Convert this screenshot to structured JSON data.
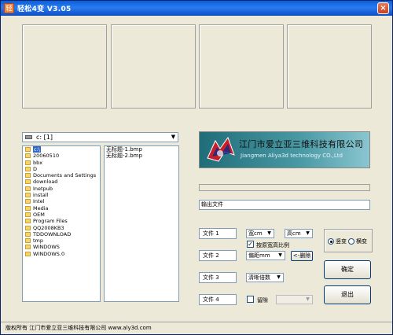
{
  "window": {
    "title": "轻松4变 V3.05",
    "close_label": "×"
  },
  "drive": {
    "selected": "c: [1]"
  },
  "folders": [
    "c:\\",
    "20060510",
    "bbx",
    "D",
    "Documents and Settings",
    "download",
    "Inetpub",
    "install",
    "Intel",
    "Media",
    "OEM",
    "Program Files",
    "QQ2008KB3",
    "TDDOWNLOAD",
    "tmp",
    "WINDOWS",
    "WINDOWS.0"
  ],
  "files": [
    "无标题-1.bmp",
    "无标题-2.bmp"
  ],
  "banner": {
    "company_cn": "江门市爱立亚三维科技有限公司",
    "company_en": "Jiangmen Aliya3d technology CO.,Ltd"
  },
  "output": {
    "value": "输出文件"
  },
  "file_buttons": [
    "文件 1",
    "文件 2",
    "文件 3",
    "文件 4"
  ],
  "options": {
    "width_unit": "宽cm",
    "height_unit": "高cm",
    "keep_ratio_label": "按原宽高比例",
    "keep_ratio_checked": true,
    "gap_unit": "偏距mm",
    "delete_label": "<-删除",
    "sharpen": "清晰倍数",
    "leave_label": "留隙",
    "leave_checked": false
  },
  "orientation": {
    "vertical_label": "竖变",
    "horizontal_label": "横变",
    "selected": "vertical"
  },
  "buttons": {
    "ok": "确定",
    "exit": "退出"
  },
  "status": {
    "text": "版权所有 江门市爱立亚三维科技有限公司 www.aly3d.com"
  }
}
